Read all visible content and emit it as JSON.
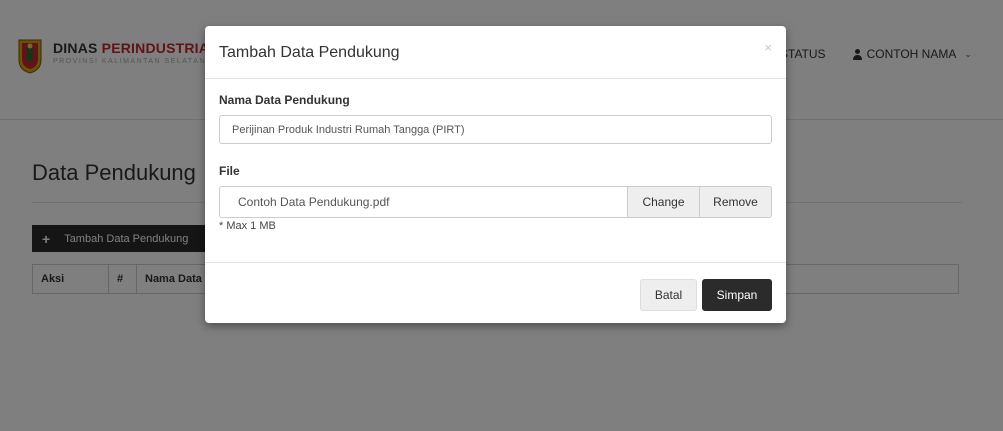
{
  "header": {
    "title_part1": "DINAS ",
    "title_part2": "PERINDUSTRIAN",
    "subtitle": "PROVINSI KALIMANTAN SELATAN",
    "nav_status": "STATUS",
    "user_name": "CONTOH NAMA",
    "user_caret": "⌄"
  },
  "main": {
    "page_title": "Data Pendukung",
    "add_button_label": "Tambah Data Pendukung",
    "table_headers": [
      "Aksi",
      "#",
      "Nama Data Pendukung",
      ""
    ]
  },
  "modal": {
    "title": "Tambah Data Pendukung",
    "close_symbol": "×",
    "name_label": "Nama Data Pendukung",
    "name_value": "Perijinan Produk Industri Rumah Tangga (PIRT)",
    "file_label": "File",
    "file_name": "Contoh Data Pendukung.pdf",
    "change_label": "Change",
    "remove_label": "Remove",
    "help_text": "* Max 1 MB",
    "cancel_label": "Batal",
    "save_label": "Simpan"
  },
  "colors": {
    "brand_red": "#c0282e",
    "dark_button": "#2b2b2b",
    "backdrop": "rgba(0,0,0,0.5)"
  }
}
